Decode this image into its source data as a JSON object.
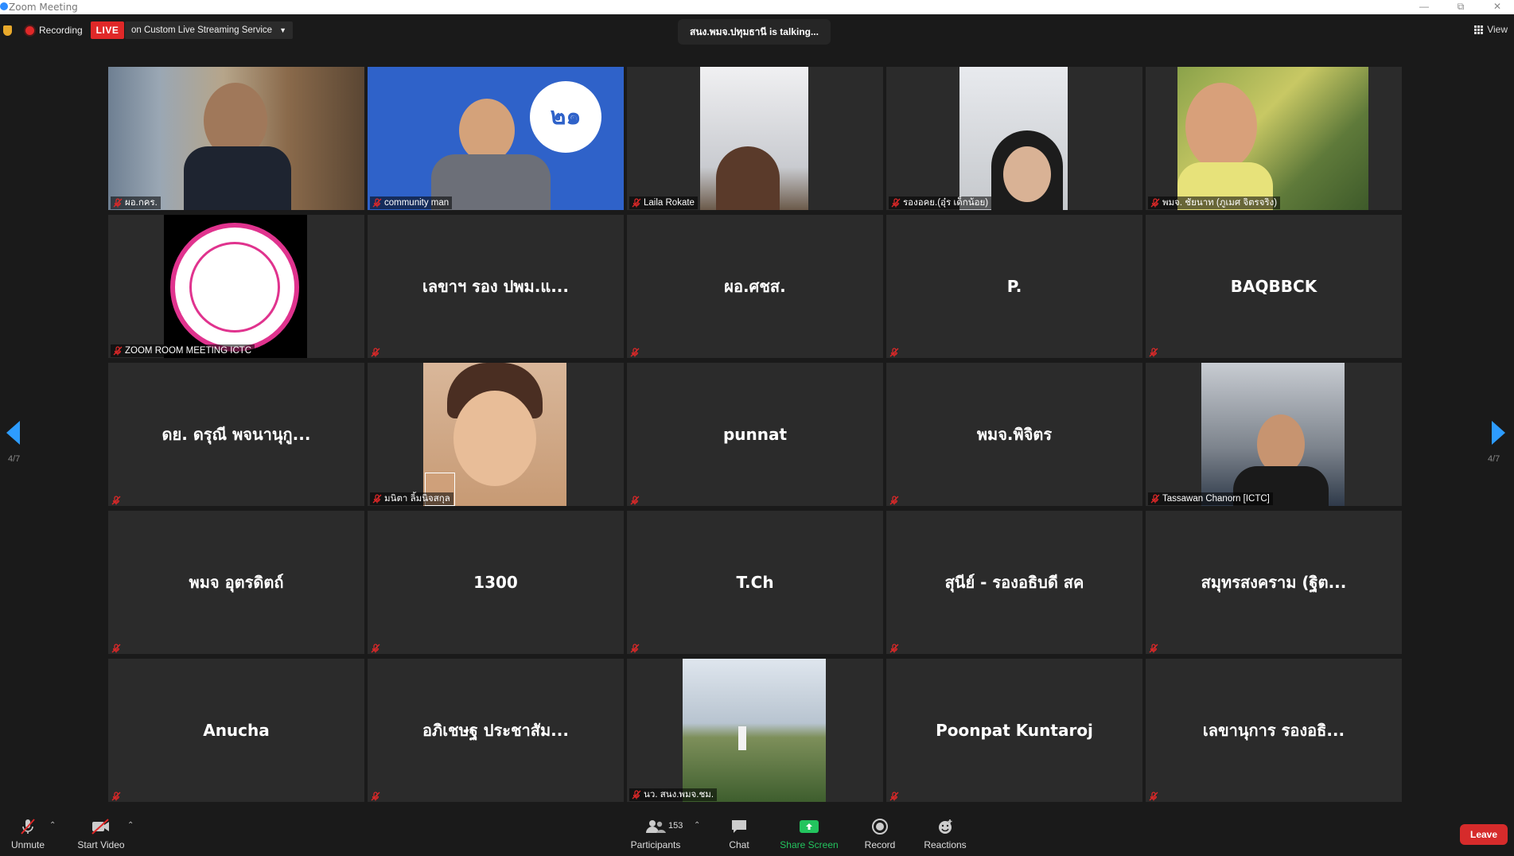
{
  "window": {
    "title": "Zoom Meeting"
  },
  "topbar": {
    "recording_label": "Recording",
    "live_label": "LIVE",
    "stream_service": "on Custom Live Streaming Service",
    "talking_text": "สนง.พมจ.ปทุมธานี is  talking...",
    "view_label": "View"
  },
  "pagination": {
    "left": "4/7",
    "right": "4/7"
  },
  "tiles": [
    {
      "type": "video",
      "label": "ผอ.กคร."
    },
    {
      "type": "video",
      "label": "community man"
    },
    {
      "type": "video",
      "label": "Laila Rokate"
    },
    {
      "type": "video",
      "label": "รองอคย.(อุ๋ร เด็กน้อย)"
    },
    {
      "type": "video",
      "label": "พมจ. ชัยนาท (ภูเมศ จิตรจริง)"
    },
    {
      "type": "video",
      "label": "ZOOM ROOM MEETING ICTC"
    },
    {
      "type": "name",
      "label": "เลขาฯ รอง ปพม.แ..."
    },
    {
      "type": "name",
      "label": "ผอ.ศชส."
    },
    {
      "type": "name",
      "label": "P."
    },
    {
      "type": "name",
      "label": "BAQBBCK"
    },
    {
      "type": "name",
      "label": "ดย. ดรุณี พจนานุกู..."
    },
    {
      "type": "video",
      "label": "มนิตา ลิ้มนิจสกุล"
    },
    {
      "type": "name",
      "label": "punnat"
    },
    {
      "type": "name",
      "label": "พมจ.พิจิตร"
    },
    {
      "type": "video",
      "label": "Tassawan Chanorn [ICTC]"
    },
    {
      "type": "name",
      "label": "พมจ อุตรดิตถ์"
    },
    {
      "type": "name",
      "label": "1300"
    },
    {
      "type": "name",
      "label": "T.Ch"
    },
    {
      "type": "name",
      "label": "สุนีย์ - รองอธิบดี สค"
    },
    {
      "type": "name",
      "label": "สมุทรสงคราม (ฐิต..."
    },
    {
      "type": "name",
      "label": "Anucha"
    },
    {
      "type": "name",
      "label": "อภิเชษฐ ประชาสัม..."
    },
    {
      "type": "video",
      "label": "นว. สนง.พมจ.ชม."
    },
    {
      "type": "name",
      "label": "Poonpat Kuntaroj"
    },
    {
      "type": "name",
      "label": "เลขานุการ รองอธิ..."
    }
  ],
  "toolbar": {
    "unmute": "Unmute",
    "start_video": "Start Video",
    "participants": "Participants",
    "participants_count": "153",
    "chat": "Chat",
    "share_screen": "Share Screen",
    "record": "Record",
    "reactions": "Reactions",
    "leave": "Leave"
  },
  "colors": {
    "accent": "#2d9cff",
    "live": "#e02828",
    "share": "#23c45e",
    "leave": "#d62b2b"
  }
}
